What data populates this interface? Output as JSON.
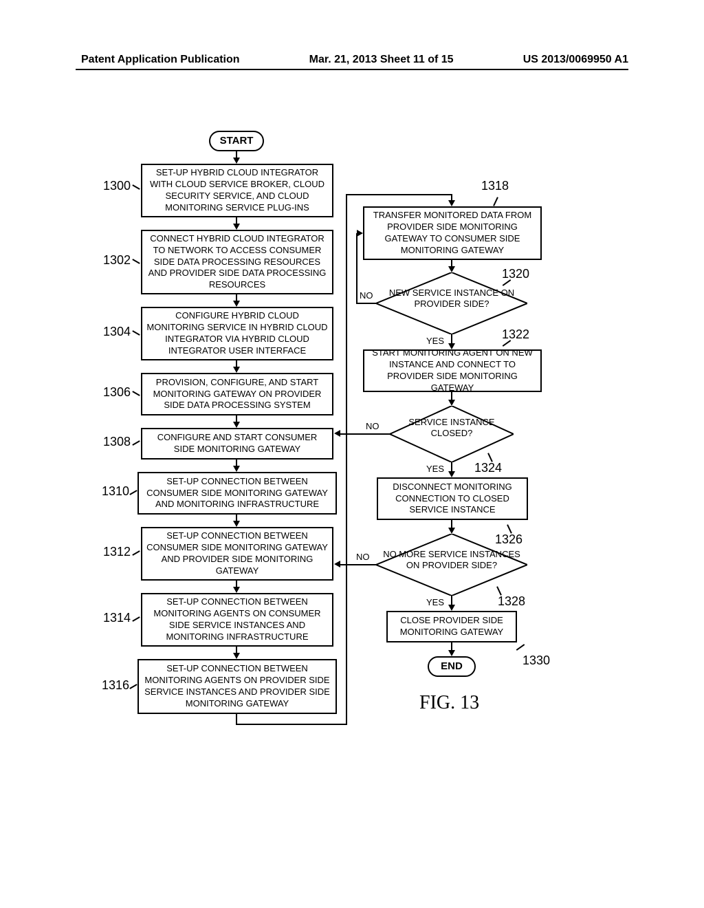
{
  "header": {
    "left": "Patent Application Publication",
    "center": "Mar. 21, 2013  Sheet 11 of 15",
    "right": "US 2013/0069950 A1"
  },
  "flow": {
    "start": "START",
    "end": "END",
    "fig": "FIG. 13",
    "step1300": "SET-UP HYBRID CLOUD INTEGRATOR WITH CLOUD SERVICE BROKER, CLOUD SECURITY SERVICE, AND CLOUD MONITORING SERVICE PLUG-INS",
    "step1302": "CONNECT HYBRID CLOUD INTEGRATOR TO NETWORK TO ACCESS CONSUMER SIDE DATA PROCESSING RESOURCES AND PROVIDER SIDE DATA PROCESSING RESOURCES",
    "step1304": "CONFIGURE HYBRID CLOUD MONITORING SERVICE IN HYBRID CLOUD INTEGRATOR VIA HYBRID CLOUD INTEGRATOR USER INTERFACE",
    "step1306": "PROVISION, CONFIGURE, AND START MONITORING GATEWAY ON PROVIDER SIDE DATA PROCESSING SYSTEM",
    "step1308": "CONFIGURE AND START CONSUMER SIDE MONITORING GATEWAY",
    "step1310": "SET-UP CONNECTION BETWEEN CONSUMER SIDE MONITORING GATEWAY AND MONITORING INFRASTRUCTURE",
    "step1312": "SET-UP CONNECTION BETWEEN CONSUMER SIDE MONITORING GATEWAY AND PROVIDER SIDE MONITORING GATEWAY",
    "step1314": "SET-UP CONNECTION BETWEEN MONITORING AGENTS ON CONSUMER SIDE SERVICE INSTANCES AND MONITORING INFRASTRUCTURE",
    "step1316": "SET-UP CONNECTION BETWEEN MONITORING AGENTS ON PROVIDER SIDE SERVICE INSTANCES AND PROVIDER SIDE MONITORING GATEWAY",
    "step1318": "TRANSFER MONITORED DATA FROM PROVIDER SIDE MONITORING GATEWAY TO CONSUMER SIDE MONITORING GATEWAY",
    "dec1320": "NEW SERVICE INSTANCE ON PROVIDER SIDE?",
    "step1322": "START MONITORING AGENT ON NEW INSTANCE AND CONNECT TO PROVIDER SIDE MONITORING GATEWAY",
    "dec1324": "SERVICE INSTANCE CLOSED?",
    "step1326": "DISCONNECT MONITORING CONNECTION TO CLOSED SERVICE INSTANCE",
    "dec1328": "NO MORE SERVICE INSTANCES ON PROVIDER SIDE?",
    "step1330": "CLOSE PROVIDER SIDE MONITORING GATEWAY",
    "yes": "YES",
    "no": "NO"
  },
  "refs": {
    "r1300": "1300",
    "r1302": "1302",
    "r1304": "1304",
    "r1306": "1306",
    "r1308": "1308",
    "r1310": "1310",
    "r1312": "1312",
    "r1314": "1314",
    "r1316": "1316",
    "r1318": "1318",
    "r1320": "1320",
    "r1322": "1322",
    "r1324": "1324",
    "r1326": "1326",
    "r1328": "1328",
    "r1330": "1330"
  }
}
